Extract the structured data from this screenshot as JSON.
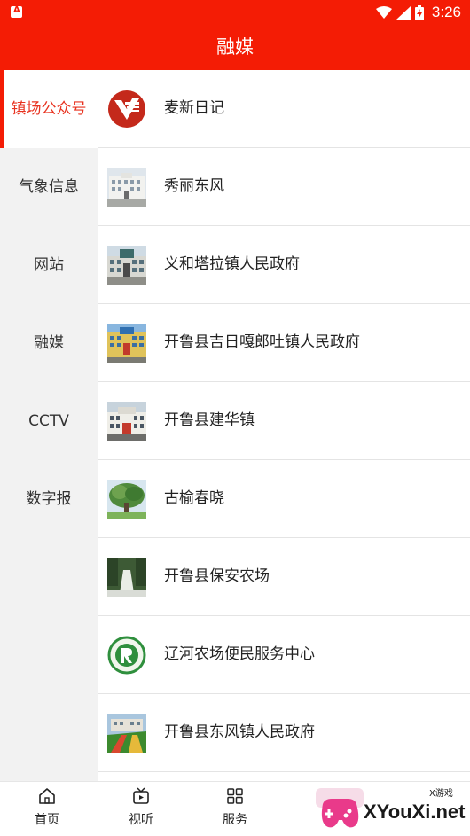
{
  "status_bar": {
    "time": "3:26"
  },
  "header": {
    "title": "融媒"
  },
  "sidebar": {
    "items": [
      {
        "label": "镇场公众号",
        "active": true
      },
      {
        "label": "气象信息",
        "active": false
      },
      {
        "label": "网站",
        "active": false
      },
      {
        "label": "融媒",
        "active": false
      },
      {
        "label": "CCTV",
        "active": false
      },
      {
        "label": "数字报",
        "active": false
      }
    ]
  },
  "list": {
    "items": [
      {
        "label": "麦新日记",
        "thumb": "red-logo-icon"
      },
      {
        "label": "秀丽东风",
        "thumb": "building-photo"
      },
      {
        "label": "义和塔拉镇人民政府",
        "thumb": "building-photo"
      },
      {
        "label": "开鲁县吉日嘎郎吐镇人民政府",
        "thumb": "building-photo"
      },
      {
        "label": "开鲁县建华镇",
        "thumb": "building-photo"
      },
      {
        "label": "古榆春晓",
        "thumb": "tree-photo"
      },
      {
        "label": "开鲁县保安农场",
        "thumb": "garden-photo"
      },
      {
        "label": "辽河农场便民服务中心",
        "thumb": "green-emblem-icon"
      },
      {
        "label": "开鲁县东风镇人民政府",
        "thumb": "building-photo"
      }
    ]
  },
  "bottom_nav": {
    "items": [
      {
        "label": "首页",
        "icon": "home-icon"
      },
      {
        "label": "视听",
        "icon": "tv-icon"
      },
      {
        "label": "服务",
        "icon": "grid-icon"
      }
    ]
  },
  "watermark": {
    "text": "XYouXi.net",
    "small": "X游戏"
  },
  "colors": {
    "brand_red": "#f41c05",
    "active_text": "#e8321f",
    "sidebar_bg": "#f2f2f2"
  }
}
